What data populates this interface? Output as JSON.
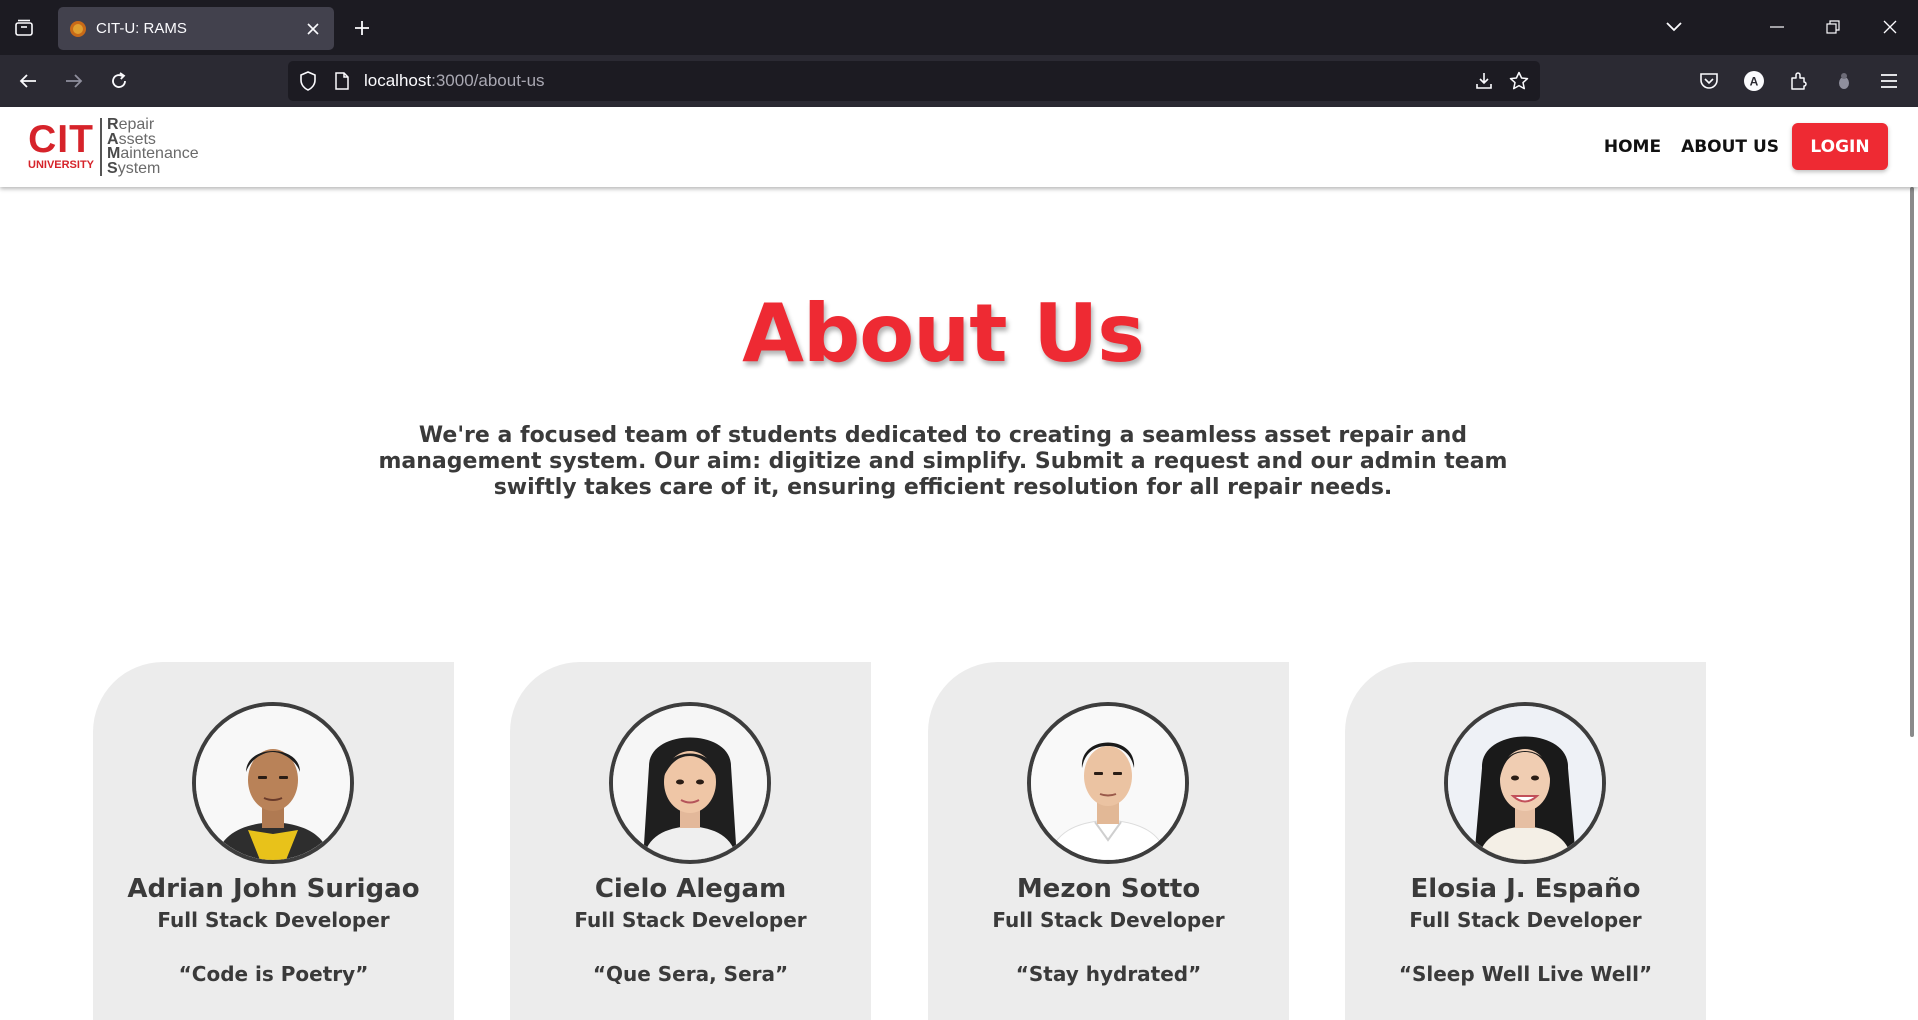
{
  "browser": {
    "tab_title": "CIT-U: RAMS",
    "url_host": "localhost",
    "url_path": ":3000/about-us",
    "profile_initial": "A"
  },
  "header": {
    "logo": {
      "cit": "CIT",
      "university": "UNIVERSITY",
      "words": [
        {
          "first": "R",
          "rest": "epair"
        },
        {
          "first": "A",
          "rest": "ssets"
        },
        {
          "first": "M",
          "rest": "aintenance"
        },
        {
          "first": "S",
          "rest": "ystem"
        }
      ]
    },
    "nav": {
      "home": "HOME",
      "about": "ABOUT US",
      "login": "LOGIN"
    }
  },
  "main": {
    "title": "About Us",
    "description": "We're a focused team of students dedicated to creating a seamless asset repair and management system. Our aim: digitize and simplify. Submit a request and our admin team swiftly takes care of it, ensuring efficient resolution for all repair needs.",
    "team": [
      {
        "name": "Adrian John Surigao",
        "role": "Full Stack Developer",
        "quote": "“Code is Poetry”",
        "shirt": "#2e2e2e",
        "accent": "#e8c21a"
      },
      {
        "name": "Cielo Alegam",
        "role": "Full Stack Developer",
        "quote": "“Que Sera, Sera”",
        "shirt": "#f2f2f2",
        "accent": "#1f1f1f"
      },
      {
        "name": "Mezon Sotto",
        "role": "Full Stack Developer",
        "quote": "“Stay hydrated”",
        "shirt": "#ffffff",
        "accent": "#1a1a1a"
      },
      {
        "name": "Elosia J. Españo",
        "role": "Full Stack Developer",
        "quote": "“Sleep Well Live Well”",
        "shirt": "#f4efe6",
        "accent": "#1a1a1a"
      }
    ]
  },
  "colors": {
    "brand_red": "#ee2a33",
    "card_bg": "#ececec",
    "text_dark": "#3a3a3a"
  }
}
